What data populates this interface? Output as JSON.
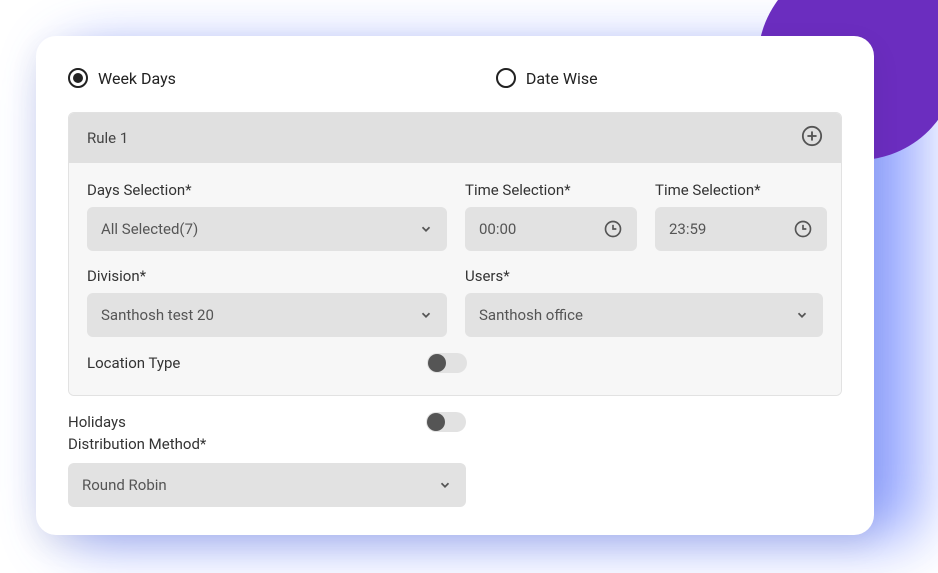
{
  "mode": {
    "options": [
      {
        "label": "Week Days",
        "selected": true
      },
      {
        "label": "Date Wise",
        "selected": false
      }
    ]
  },
  "rule": {
    "title": "Rule 1",
    "fields": {
      "days_label": "Days Selection*",
      "days_value": "All Selected(7)",
      "time1_label": "Time Selection*",
      "time1_value": "00:00",
      "time2_label": "Time Selection*",
      "time2_value": "23:59",
      "division_label": "Division*",
      "division_value": "Santhosh test 20",
      "users_label": "Users*",
      "users_value": "Santhosh office",
      "location_label": "Location Type"
    }
  },
  "footer": {
    "holidays_label": "Holidays",
    "dist_label": "Distribution Method*",
    "dist_value": "Round Robin"
  }
}
